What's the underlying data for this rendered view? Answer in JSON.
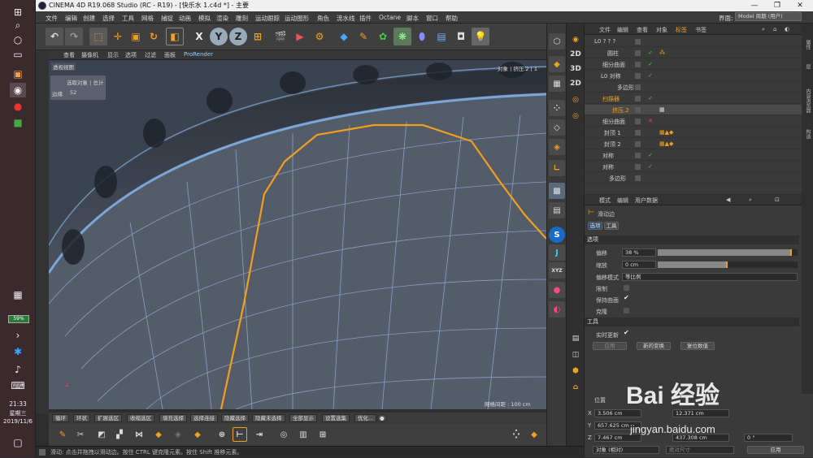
{
  "app": {
    "title": "CINEMA 4D R19.068 Studio (RC - R19) - [快乐水 1.c4d *] - 主要",
    "layout_label": "界面:",
    "layout_value": "Model 周期 (用户)"
  },
  "menu": [
    "文件",
    "编辑",
    "创建",
    "选择",
    "工具",
    "网格",
    "捕捉",
    "动画",
    "模拟",
    "渲染",
    "雕刻",
    "运动跟踪",
    "运动图形",
    "角色",
    "流水线",
    "插件",
    "Octane",
    "脚本",
    "窗口",
    "帮助"
  ],
  "viewport_menu": [
    "查看",
    "摄像机",
    "显示",
    "选项",
    "过滤",
    "面板",
    "ProRender"
  ],
  "viewport": {
    "label": "透视视图",
    "hud_title": "选取对象 | 总计",
    "hud_row_label": "边缘",
    "hud_row_value": "52",
    "top_right": "对象 | 挤压.2 | 1",
    "grid_spacing": "网格间距 : 100 cm"
  },
  "object_panel": {
    "tabs": [
      "文件",
      "编辑",
      "查看",
      "对象",
      "标签",
      "书签"
    ],
    "rows": [
      {
        "name": "L0 ? ? ?",
        "indent": 0
      },
      {
        "name": "圆柱",
        "indent": 14
      },
      {
        "name": "细分曲面",
        "indent": 8
      },
      {
        "name": "L0 对称",
        "indent": 14
      },
      {
        "name": "多边形",
        "indent": 28
      },
      {
        "name": "扫描器",
        "indent": 8
      },
      {
        "name": "挤压.2",
        "indent": 20
      },
      {
        "name": "细分曲面",
        "indent": 8
      },
      {
        "name": "封顶 1",
        "indent": 20
      },
      {
        "name": "封顶 2",
        "indent": 20
      },
      {
        "name": "对称",
        "indent": 8
      },
      {
        "name": "对称",
        "indent": 8
      },
      {
        "name": "多边形",
        "indent": 20
      }
    ]
  },
  "attr_panel": {
    "tabs": [
      "模式",
      "编辑",
      "用户数据"
    ],
    "tool_name": "滑动边",
    "subtabs": [
      "选项",
      "工具"
    ],
    "section_options": "选项",
    "offset_label": "偏移",
    "offset_value": "38 %",
    "offset_fill": 0.96,
    "scale_label": "缩放",
    "scale_value": "0 cm",
    "scale_fill": 0.5,
    "mode_label": "偏移模式",
    "mode_value": "等比例",
    "limit_label": "限制",
    "keep_label": "保持曲面",
    "clone_label": "克隆",
    "section_tool": "工具",
    "realtime_label": "实时更新",
    "apply_label": "应用",
    "new_label": "新的变换",
    "reset_label": "复位数值"
  },
  "coord_panel": {
    "header": "位置",
    "x_label": "X",
    "x_value": "3.506 cm",
    "y_label": "Y",
    "y_value": "657.625 cm",
    "z_label": "Z",
    "z_value": "7.467 cm",
    "x2_value": "12.371 cm",
    "z2_value": "437.308 cm",
    "rot_value": "0 °",
    "mode_value": "对象 (相对)",
    "size_mode": "绝对尺寸",
    "apply_label": "应用"
  },
  "bottom_bar": [
    "循环",
    "环状",
    "扩展选区",
    "收缩选区",
    "填充选择",
    "选择连接",
    "隐藏选择",
    "隐藏未选择",
    "全部显示",
    "设置选集",
    "优化..."
  ],
  "status": "滑动: 点击并拖拽以滑动边。按住 CTRL 键克隆元素。按住 Shift 推移元素。",
  "taskbar": {
    "battery": "59%",
    "time": "21:33",
    "weekday": "星期三",
    "date": "2019/11/6"
  },
  "watermark": {
    "text": "Bai 经验",
    "url": "jingyan.baidu.com"
  },
  "far_right_tabs": [
    "属性",
    "层",
    "内容浏览器",
    "构造"
  ]
}
